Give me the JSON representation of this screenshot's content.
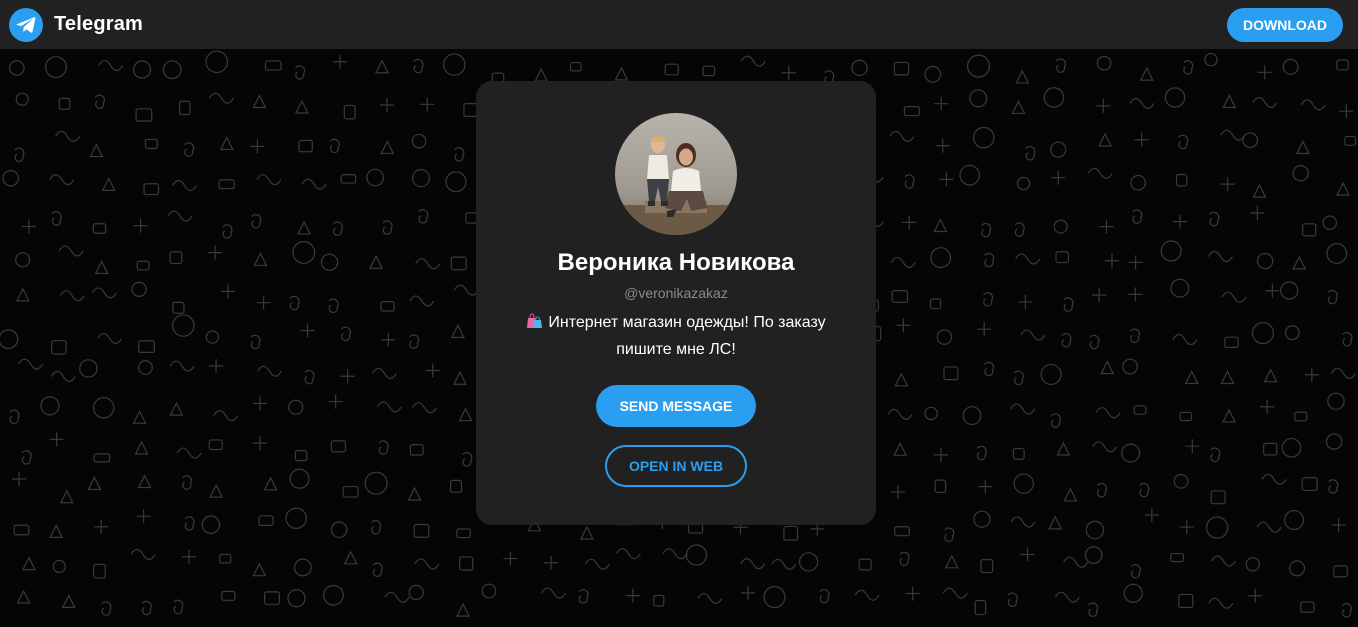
{
  "header": {
    "app_name": "Telegram",
    "logo_icon": "telegram-plane-icon",
    "download_label": "DOWNLOAD"
  },
  "profile": {
    "name": "Вероника Новикова",
    "username": "@veronikazakaz",
    "bio_emoji_icon": "shopping-bags-icon",
    "bio": "Интернет магазин одежды! По заказу пишите мне ЛС!",
    "send_message_label": "SEND MESSAGE",
    "open_web_label": "OPEN IN WEB"
  },
  "colors": {
    "accent": "#2a9ef1",
    "topbar": "#212121",
    "card": "#212121",
    "background": "#050505",
    "pattern_stroke": "#3c4a3c"
  }
}
